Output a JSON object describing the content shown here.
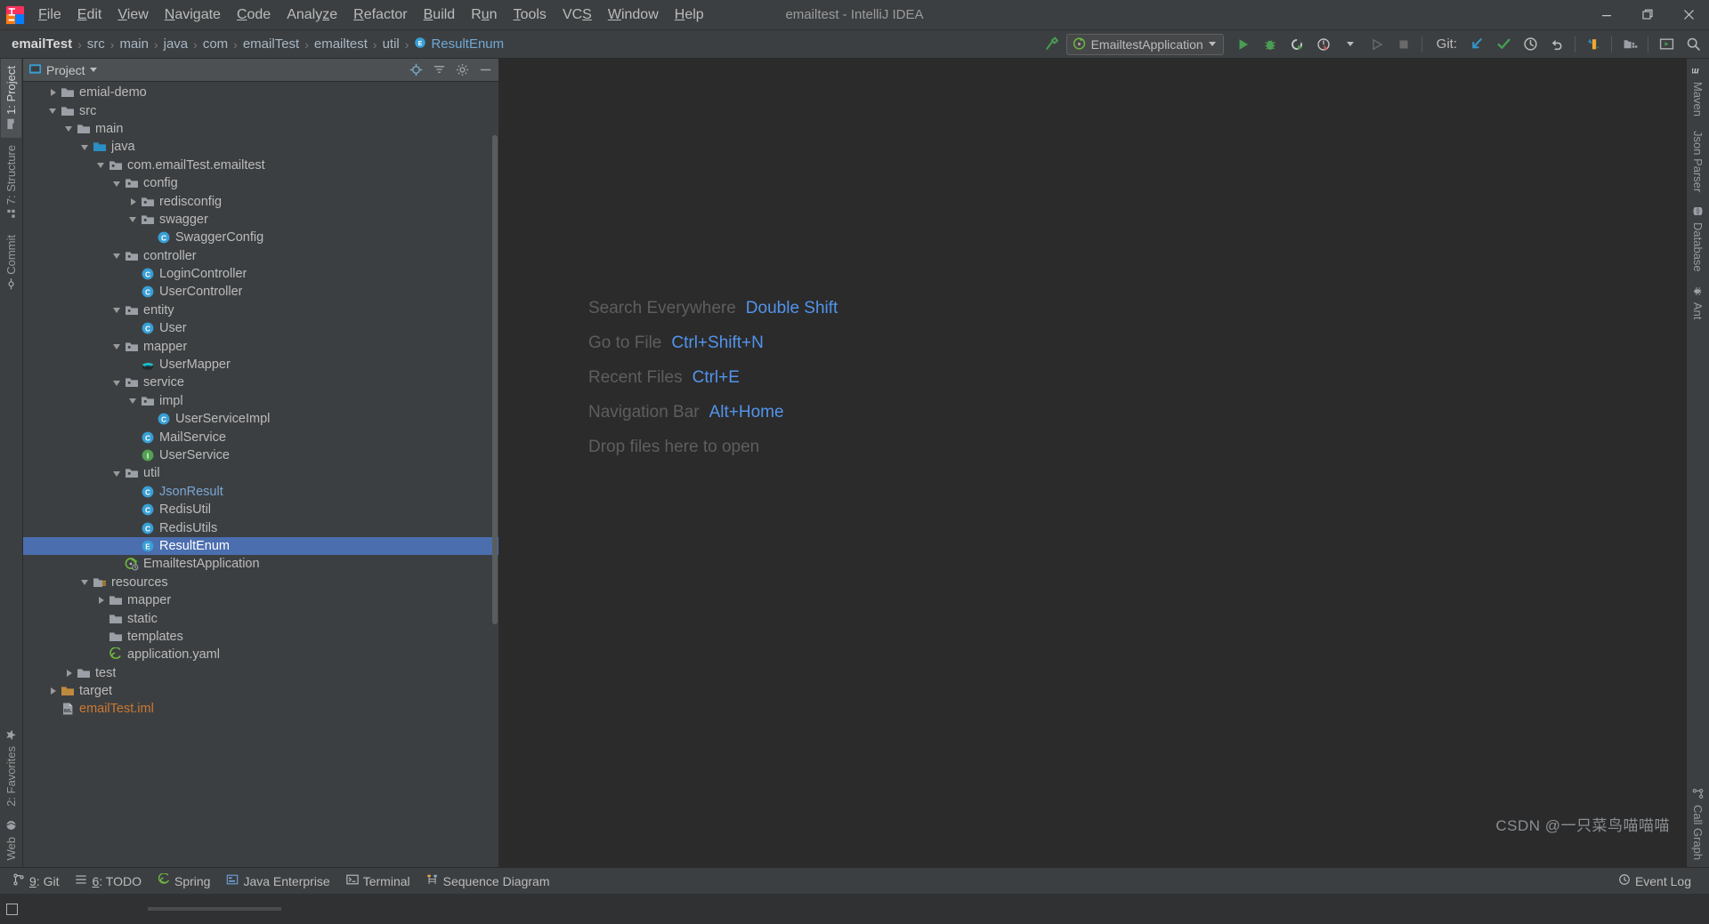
{
  "window": {
    "title": "emailtest - IntelliJ IDEA",
    "minimize": "—",
    "restore": "❐",
    "close": "✕",
    "logo_name": "intellij-idea-logo"
  },
  "menubar": {
    "items": [
      {
        "label": "File"
      },
      {
        "label": "Edit"
      },
      {
        "label": "View"
      },
      {
        "label": "Navigate"
      },
      {
        "label": "Code"
      },
      {
        "label": "Analyze"
      },
      {
        "label": "Refactor"
      },
      {
        "label": "Build"
      },
      {
        "label": "Run"
      },
      {
        "label": "Tools"
      },
      {
        "label": "VCS"
      },
      {
        "label": "Window"
      },
      {
        "label": "Help"
      }
    ]
  },
  "breadcrumb": {
    "separator": "›",
    "items": [
      {
        "label": "emailTest",
        "style": "root"
      },
      {
        "label": "src",
        "style": ""
      },
      {
        "label": "main",
        "style": ""
      },
      {
        "label": "java",
        "style": ""
      },
      {
        "label": "com",
        "style": ""
      },
      {
        "label": "emailTest",
        "style": ""
      },
      {
        "label": "emailtest",
        "style": ""
      },
      {
        "label": "util",
        "style": ""
      },
      {
        "label": "ResultEnum",
        "style": "active",
        "icon": "enum-icon"
      }
    ]
  },
  "toolbar": {
    "build_icon": "hammer-icon",
    "run_config": {
      "label": "EmailtestApplication",
      "icon": "spring-boot-icon",
      "dropdown": "▾"
    },
    "run_button": "run-icon",
    "debug_button": "debug-icon",
    "run_coverage_button": "run-with-coverage-icon",
    "profile_button": "profiler-icon",
    "profile_dropdown": "▾",
    "attach_button": "run-disabled-icon",
    "stop_button": "stop-icon",
    "git_label": "Git:",
    "git_update": "update-project-icon",
    "git_commit": "commit-icon",
    "git_history": "history-icon",
    "git_rollback": "rollback-icon",
    "bookmark_button": "bookmarks-icon",
    "project_structure_button": "project-structure-icon",
    "run_anything_button": "run-anything-icon",
    "search_button": "search-everywhere-icon"
  },
  "left_strip": {
    "top": [
      {
        "label": "1: Project",
        "icon": "project-icon",
        "selected": true
      },
      {
        "label": "7: Structure",
        "icon": "structure-icon",
        "selected": false
      },
      {
        "label": "Commit",
        "icon": "commit-icon",
        "selected": false
      }
    ],
    "bottom": [
      {
        "label": "2: Favorites",
        "icon": "star-icon",
        "selected": false
      },
      {
        "label": "Web",
        "icon": "web-icon",
        "selected": false
      }
    ]
  },
  "right_strip": {
    "top": [
      {
        "label": "Maven",
        "icon": "maven-icon"
      },
      {
        "label": "Json Parser",
        "icon": "json-icon"
      },
      {
        "label": "Database",
        "icon": "database-icon"
      },
      {
        "label": "Ant",
        "icon": "ant-icon"
      }
    ],
    "bottom": [
      {
        "label": "Call Graph",
        "icon": "call-graph-icon"
      }
    ]
  },
  "project_panel": {
    "title": "Project",
    "title_icon": "project-view-icon",
    "title_dropdown": "▾",
    "locate_button": "locate-icon",
    "collapse_button": "collapse-all-icon",
    "settings_button": "gear-icon",
    "hide_button": "hide-icon",
    "tree": [
      {
        "depth": 1,
        "arrow": "collapsed",
        "icon": "folder-icon",
        "label": "emial-demo",
        "style": ""
      },
      {
        "depth": 1,
        "arrow": "expanded",
        "icon": "folder-icon",
        "label": "src",
        "style": ""
      },
      {
        "depth": 2,
        "arrow": "expanded",
        "icon": "folder-icon",
        "label": "main",
        "style": ""
      },
      {
        "depth": 3,
        "arrow": "expanded",
        "icon": "source-folder-icon",
        "label": "java",
        "style": ""
      },
      {
        "depth": 4,
        "arrow": "expanded",
        "icon": "package-icon",
        "label": "com.emailTest.emailtest",
        "style": ""
      },
      {
        "depth": 5,
        "arrow": "expanded",
        "icon": "package-icon",
        "label": "config",
        "style": ""
      },
      {
        "depth": 6,
        "arrow": "collapsed",
        "icon": "package-icon",
        "label": "redisconfig",
        "style": ""
      },
      {
        "depth": 6,
        "arrow": "expanded",
        "icon": "package-icon",
        "label": "swagger",
        "style": ""
      },
      {
        "depth": 7,
        "arrow": "none",
        "icon": "class-icon",
        "label": "SwaggerConfig",
        "style": ""
      },
      {
        "depth": 5,
        "arrow": "expanded",
        "icon": "package-icon",
        "label": "controller",
        "style": ""
      },
      {
        "depth": 6,
        "arrow": "none",
        "icon": "class-icon",
        "label": "LoginController",
        "style": ""
      },
      {
        "depth": 6,
        "arrow": "none",
        "icon": "class-icon",
        "label": "UserController",
        "style": ""
      },
      {
        "depth": 5,
        "arrow": "expanded",
        "icon": "package-icon",
        "label": "entity",
        "style": ""
      },
      {
        "depth": 6,
        "arrow": "none",
        "icon": "class-icon",
        "label": "User",
        "style": ""
      },
      {
        "depth": 5,
        "arrow": "expanded",
        "icon": "package-icon",
        "label": "mapper",
        "style": ""
      },
      {
        "depth": 6,
        "arrow": "none",
        "icon": "mybatis-mapper-icon",
        "label": "UserMapper",
        "style": ""
      },
      {
        "depth": 5,
        "arrow": "expanded",
        "icon": "package-icon",
        "label": "service",
        "style": ""
      },
      {
        "depth": 6,
        "arrow": "expanded",
        "icon": "package-icon",
        "label": "impl",
        "style": ""
      },
      {
        "depth": 7,
        "arrow": "none",
        "icon": "class-icon",
        "label": "UserServiceImpl",
        "style": ""
      },
      {
        "depth": 6,
        "arrow": "none",
        "icon": "class-icon",
        "label": "MailService",
        "style": ""
      },
      {
        "depth": 6,
        "arrow": "none",
        "icon": "interface-icon",
        "label": "UserService",
        "style": ""
      },
      {
        "depth": 5,
        "arrow": "expanded",
        "icon": "package-icon",
        "label": "util",
        "style": ""
      },
      {
        "depth": 6,
        "arrow": "none",
        "icon": "class-icon",
        "label": "JsonResult",
        "style": "blue"
      },
      {
        "depth": 6,
        "arrow": "none",
        "icon": "class-icon",
        "label": "RedisUtil",
        "style": ""
      },
      {
        "depth": 6,
        "arrow": "none",
        "icon": "class-icon",
        "label": "RedisUtils",
        "style": ""
      },
      {
        "depth": 6,
        "arrow": "none",
        "icon": "enum-icon",
        "label": "ResultEnum",
        "style": "",
        "selected": true
      },
      {
        "depth": 5,
        "arrow": "none",
        "icon": "spring-boot-app-icon",
        "label": "EmailtestApplication",
        "style": ""
      },
      {
        "depth": 3,
        "arrow": "expanded",
        "icon": "resources-folder-icon",
        "label": "resources",
        "style": ""
      },
      {
        "depth": 4,
        "arrow": "collapsed",
        "icon": "folder-icon",
        "label": "mapper",
        "style": ""
      },
      {
        "depth": 4,
        "arrow": "none",
        "icon": "folder-icon",
        "label": "static",
        "style": ""
      },
      {
        "depth": 4,
        "arrow": "none",
        "icon": "folder-icon",
        "label": "templates",
        "style": ""
      },
      {
        "depth": 4,
        "arrow": "none",
        "icon": "yaml-icon",
        "label": "application.yaml",
        "style": ""
      },
      {
        "depth": 2,
        "arrow": "collapsed",
        "icon": "folder-icon",
        "label": "test",
        "style": ""
      },
      {
        "depth": 1,
        "arrow": "collapsed",
        "icon": "target-folder-icon",
        "label": "target",
        "style": ""
      },
      {
        "depth": 1,
        "arrow": "none",
        "icon": "iml-icon",
        "label": "emailTest.iml",
        "style": "red"
      }
    ]
  },
  "editor": {
    "hints": [
      {
        "text": "Search Everywhere",
        "key": "Double Shift"
      },
      {
        "text": "Go to File",
        "key": "Ctrl+Shift+N"
      },
      {
        "text": "Recent Files",
        "key": "Ctrl+E"
      },
      {
        "text": "Navigation Bar",
        "key": "Alt+Home"
      },
      {
        "text": "Drop files here to open",
        "key": ""
      }
    ]
  },
  "statusbar": {
    "items": [
      {
        "label": "9: Git",
        "icon": "git-branch-icon",
        "underline": "9"
      },
      {
        "label": "6: TODO",
        "icon": "todo-icon",
        "underline": "6"
      },
      {
        "label": "Spring",
        "icon": "spring-icon",
        "underline": ""
      },
      {
        "label": "Java Enterprise",
        "icon": "java-enterprise-icon",
        "underline": ""
      },
      {
        "label": "Terminal",
        "icon": "terminal-icon",
        "underline": ""
      },
      {
        "label": "Sequence Diagram",
        "icon": "sequence-diagram-icon",
        "underline": ""
      }
    ],
    "event_log": {
      "label": "Event Log",
      "icon": "event-log-icon"
    }
  },
  "watermark": {
    "text": "CSDN @一只菜鸟喵喵喵"
  },
  "colors": {
    "selection": "#4b6eaf",
    "accent_blue": "#5394ec",
    "editor_bg": "#2b2b2b",
    "chrome_bg": "#3c3f41",
    "text": "#bbbbbb",
    "green": "#499c54",
    "orange": "#cc7832"
  }
}
